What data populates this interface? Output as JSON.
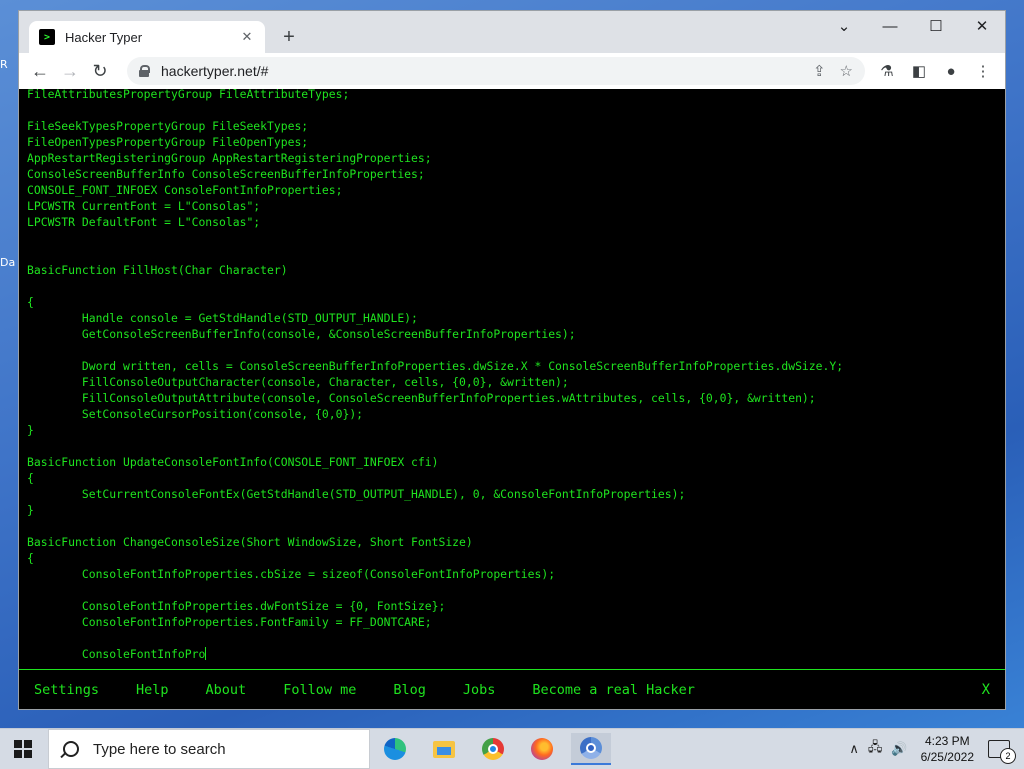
{
  "desktop": {
    "fragment_1": "R",
    "fragment_2": "Da"
  },
  "browser": {
    "tab_title": "Hacker Typer",
    "favicon_glyph": ">",
    "tab_close": "✕",
    "new_tab": "+",
    "url": "hackertyper.net/#",
    "window_controls": {
      "minimize": "—",
      "maximize": "☐",
      "close": "✕"
    }
  },
  "code_lines": [
    "FileAttributesPropertyGroup FileAttributeTypes;",
    "",
    "FileSeekTypesPropertyGroup FileSeekTypes;",
    "FileOpenTypesPropertyGroup FileOpenTypes;",
    "AppRestartRegisteringGroup AppRestartRegisteringProperties;",
    "ConsoleScreenBufferInfo ConsoleScreenBufferInfoProperties;",
    "CONSOLE_FONT_INFOEX ConsoleFontInfoProperties;",
    "LPCWSTR CurrentFont = L\"Consolas\";",
    "LPCWSTR DefaultFont = L\"Consolas\";",
    "",
    "",
    "BasicFunction FillHost(Char Character)",
    "",
    "{",
    "        Handle console = GetStdHandle(STD_OUTPUT_HANDLE);",
    "        GetConsoleScreenBufferInfo(console, &ConsoleScreenBufferInfoProperties);",
    "",
    "        Dword written, cells = ConsoleScreenBufferInfoProperties.dwSize.X * ConsoleScreenBufferInfoProperties.dwSize.Y;",
    "        FillConsoleOutputCharacter(console, Character, cells, {0,0}, &written);",
    "        FillConsoleOutputAttribute(console, ConsoleScreenBufferInfoProperties.wAttributes, cells, {0,0}, &written);",
    "        SetConsoleCursorPosition(console, {0,0});",
    "}",
    "",
    "BasicFunction UpdateConsoleFontInfo(CONSOLE_FONT_INFOEX cfi)",
    "{",
    "        SetCurrentConsoleFontEx(GetStdHandle(STD_OUTPUT_HANDLE), 0, &ConsoleFontInfoProperties);",
    "}",
    "",
    "BasicFunction ChangeConsoleSize(Short WindowSize, Short FontSize)",
    "{",
    "        ConsoleFontInfoProperties.cbSize = sizeof(ConsoleFontInfoProperties);",
    "",
    "        ConsoleFontInfoProperties.dwFontSize = {0, FontSize};",
    "        ConsoleFontInfoProperties.FontFamily = FF_DONTCARE;",
    "",
    "        ConsoleFontInfoPro"
  ],
  "hacker_nav": {
    "items": [
      "Settings",
      "Help",
      "About",
      "Follow me",
      "Blog",
      "Jobs",
      "Become a real Hacker"
    ],
    "close": "X"
  },
  "taskbar": {
    "search_placeholder": "Type here to search",
    "time": "4:23 PM",
    "date": "6/25/2022",
    "notification_count": "2"
  },
  "colors": {
    "terminal_green": "#1fe41f",
    "terminal_bg": "#000000"
  }
}
